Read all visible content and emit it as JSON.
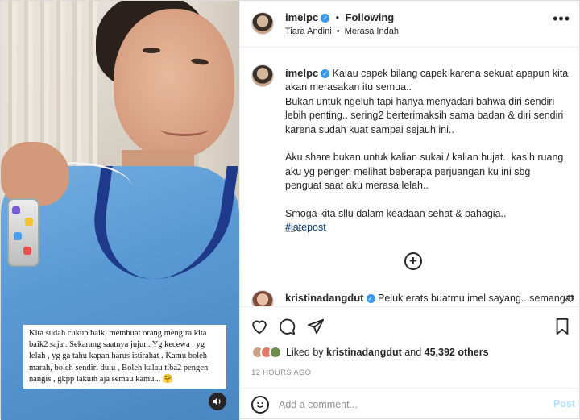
{
  "post": {
    "username": "imelpc",
    "following_label": "Following",
    "separator": "•",
    "audio_artist": "Tiara Andini",
    "audio_dot": "•",
    "audio_song": "Merasa Indah",
    "more_icon": "more-horizontal-icon"
  },
  "media": {
    "caption_overlay": "Kita sudah cukup baik, membuat orang mengira kita baik2 saja.. Sekarang saatnya jujur.. Yg kecewa , yg lelah , yg ga tahu kapan harus istirahat . Kamu boleh marah, boleh sendiri dulu , Boleh kalau tiba2 pengen nangis , gkpp lakuin aja semau kamu... 🤗",
    "sound_icon": "speaker-icon"
  },
  "caption": {
    "username": "imelpc",
    "line1": "Kalau capek bilang capek karena sekuat apapun kita akan merasakan itu semua..",
    "line2": "Bukan untuk ngeluh tapi hanya menyadari bahwa diri sendiri lebih penting.. sering2 berterimaksih sama badan & diri sendiri karena sudah kuat sampai sejauh ini..",
    "line3": "Aku share bukan untuk kalian sukai / kalian hujat.. kasih ruang aku yg pengen melihat beberapa perjuangan ku ini sbg penguat saat aku merasa lelah..",
    "line4": "Smoga kita sllu dalam keadaan sehat & bahagia..",
    "hashtag": "#latepost",
    "time": "12h"
  },
  "comment": {
    "username": "kristinadangdut",
    "text": "Peluk erats buatmu imel sayang...semangat"
  },
  "actions": {
    "liked_by_prefix": "Liked by",
    "liked_by_user": "kristinadangdut",
    "and": "and",
    "others": "45,392 others",
    "time_ago": "12 HOURS AGO"
  },
  "add_comment": {
    "placeholder": "Add a comment...",
    "post_label": "Post"
  },
  "colors": {
    "accent": "#0095f6",
    "verified": "#3897f0",
    "muted": "#8e8e8e"
  }
}
